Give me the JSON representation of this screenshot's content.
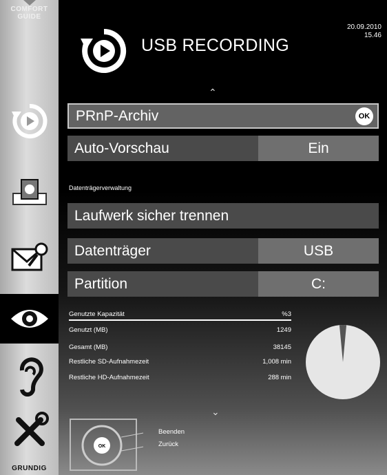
{
  "sidebar": {
    "comfort_line1": "COMFORT",
    "comfort_line2": "GUIDE",
    "brand": "GRUNDIG"
  },
  "header": {
    "title": "USB RECORDING",
    "date": "20.09.2010",
    "time": "15.46"
  },
  "menu": {
    "archive_label": "PRnP-Archiv",
    "ok_label": "OK",
    "preview_label": "Auto-Vorschau",
    "preview_value": "Ein",
    "section_title": "Datenträgerverwaltung",
    "unmount_label": "Laufwerk sicher trennen",
    "drive_label": "Datenträger",
    "drive_value": "USB",
    "partition_label": "Partition",
    "partition_value": "C:"
  },
  "stats": {
    "used_capacity_label": "Genutzte Kapazität",
    "used_capacity_value": "%3",
    "used_mb_label": "Genutzt (MB)",
    "used_mb_value": "1249",
    "total_mb_label": "Gesamt (MB)",
    "total_mb_value": "38145",
    "sd_time_label": "Restliche SD-Aufnahmezeit",
    "sd_time_value": "1,008 min",
    "hd_time_label": "Restliche HD-Aufnahmezeit",
    "hd_time_value": "288 min",
    "used_fraction": 0.03
  },
  "help": {
    "ok_key": "OK",
    "exit_label": "Beenden",
    "back_label": "Zurück"
  },
  "colors": {
    "row_bg": "#4a4a4a",
    "value_bg": "#6f6f6f",
    "pie_used": "#555555",
    "pie_free": "#e6e6e6"
  }
}
